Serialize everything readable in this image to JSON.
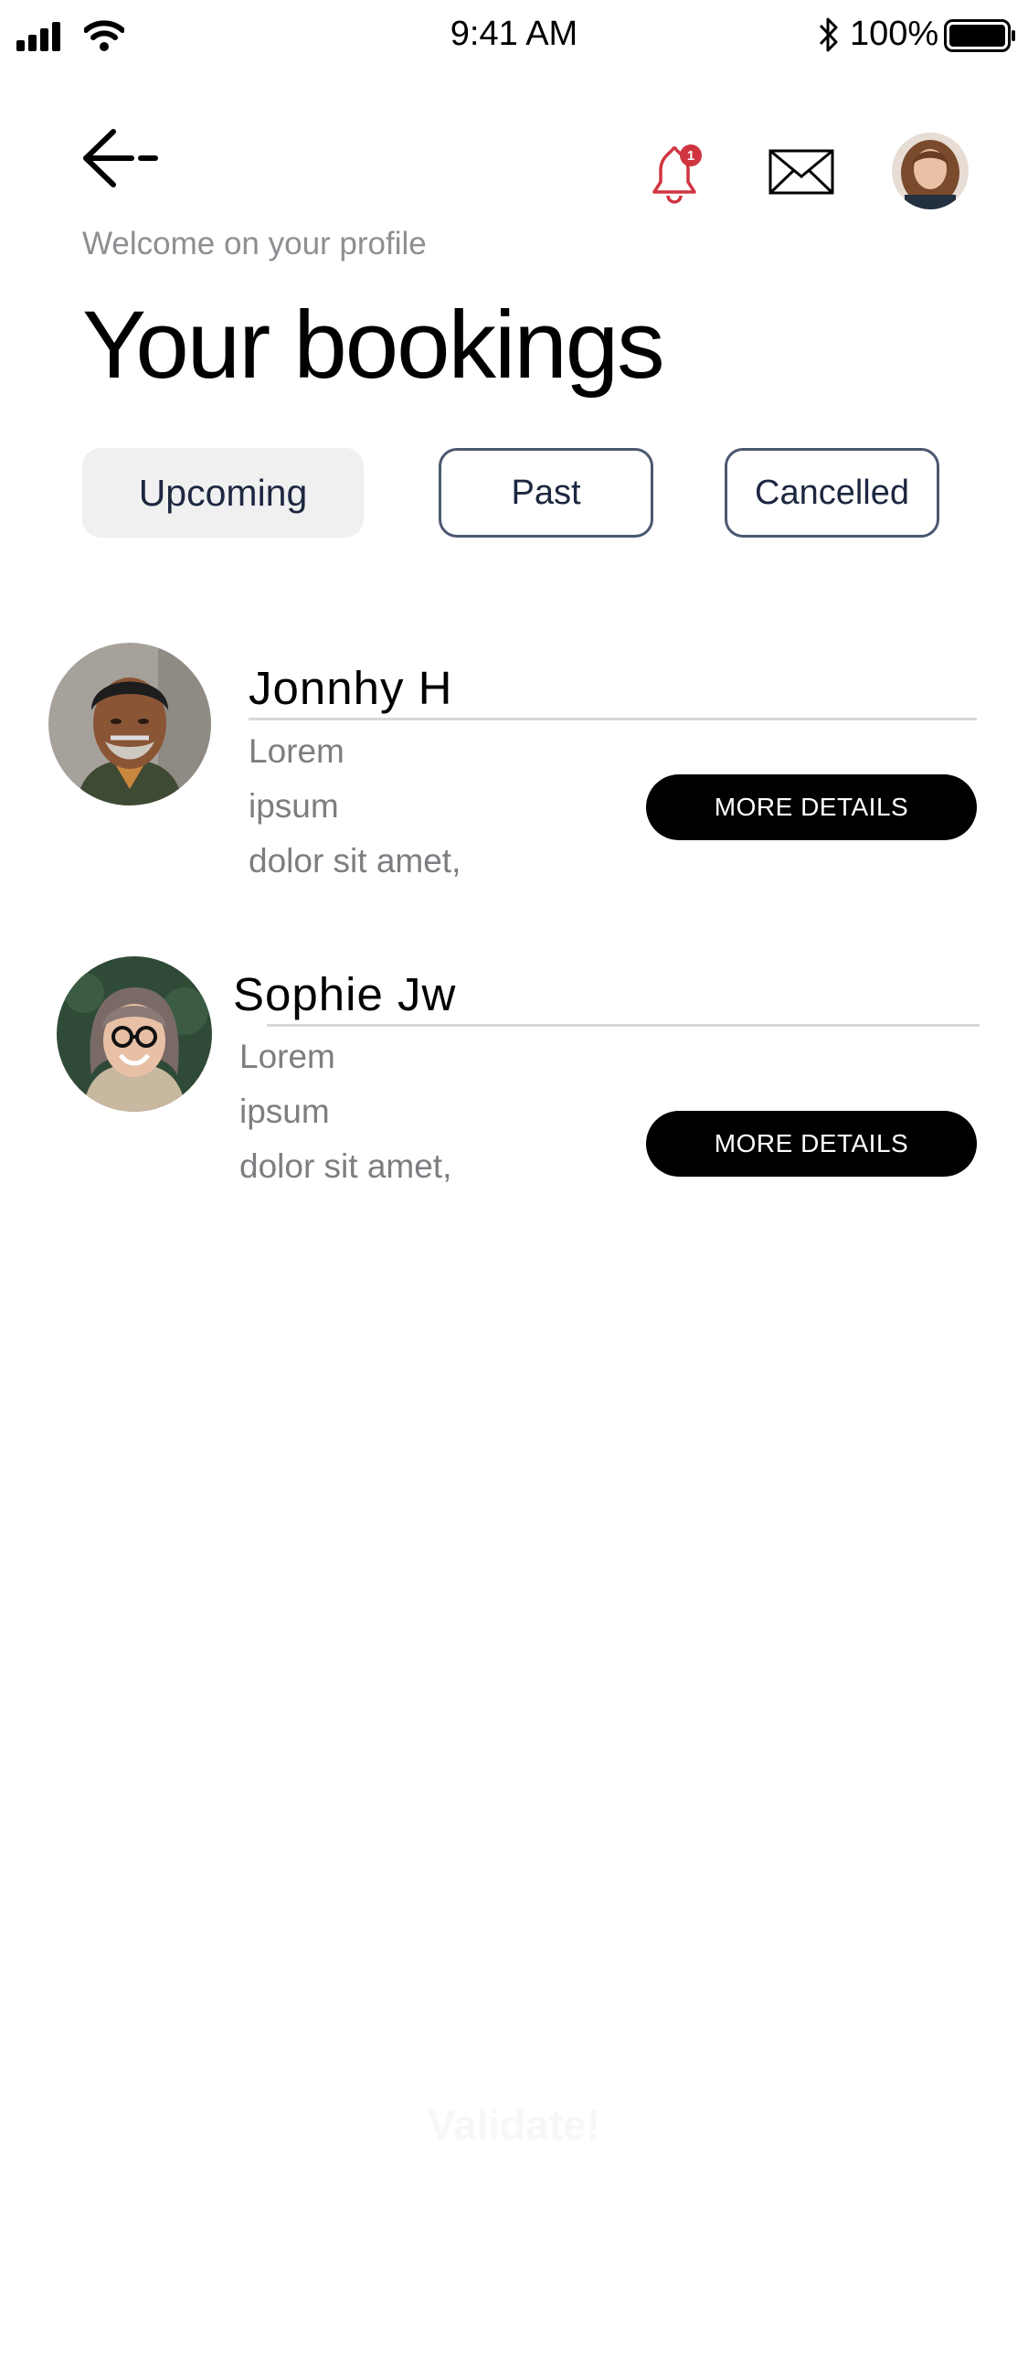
{
  "status_bar": {
    "time": "9:41 AM",
    "battery": "100%"
  },
  "header": {
    "welcome": "Welcome on your profile",
    "title": "Your bookings",
    "notification_count": "1"
  },
  "tabs": [
    {
      "label": "Upcoming",
      "selected": true
    },
    {
      "label": "Past",
      "selected": false
    },
    {
      "label": "Cancelled",
      "selected": false
    }
  ],
  "bookings": [
    {
      "name": "Jonnhy H",
      "lines": [
        "Lorem",
        "ipsum",
        "dolor sit amet,"
      ],
      "button": "MORE DETAILS"
    },
    {
      "name": "Sophie Jw",
      "lines": [
        "Lorem",
        "ipsum",
        "dolor sit amet,"
      ],
      "button": "MORE DETAILS"
    }
  ],
  "footer": {
    "validate_label": "Validate!"
  },
  "colors": {
    "accent": "#d0353f",
    "tab_border": "#4b5871",
    "button": "#000000"
  }
}
